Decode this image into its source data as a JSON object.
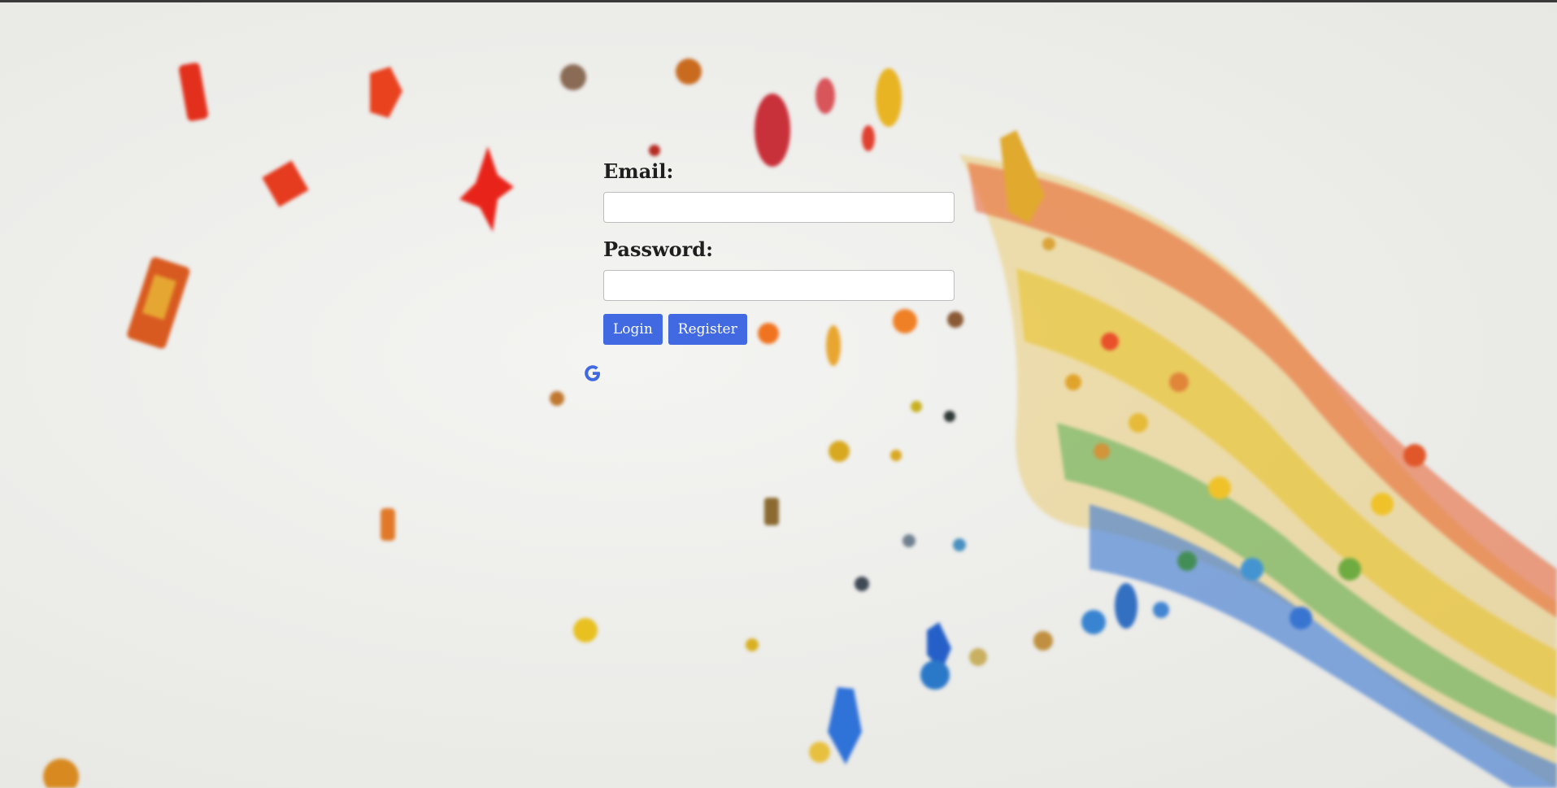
{
  "form": {
    "email_label": "Email:",
    "email_value": "",
    "password_label": "Password:",
    "password_value": "",
    "login_label": "Login",
    "register_label": "Register"
  },
  "icons": {
    "google": "google-icon"
  },
  "colors": {
    "button": "#4169e1",
    "google_icon": "#4169e1",
    "label_text": "#1f1f1f"
  }
}
